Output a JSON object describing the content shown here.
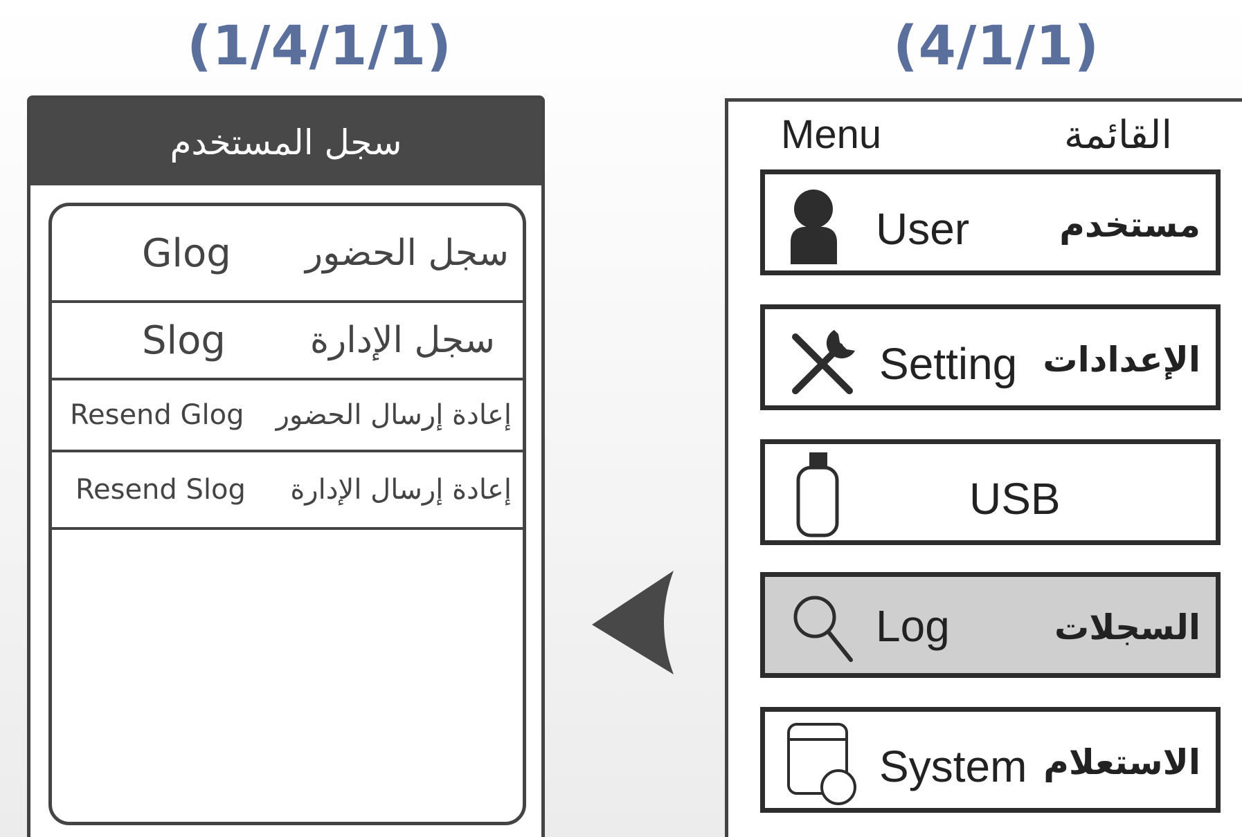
{
  "steps": {
    "left_label": "(1/4/1/1)",
    "right_label": "(4/1/1)"
  },
  "left_screen": {
    "title": "سجل المستخدم",
    "rows": [
      {
        "ar": "سجل الحضور",
        "en": "Glog"
      },
      {
        "ar": "سجل الإدارة",
        "en": "Slog"
      },
      {
        "ar": "إعادة إرسال الحضور",
        "en": "Resend Glog"
      },
      {
        "ar": "إعادة إرسال الإدارة",
        "en": "Resend Slog"
      }
    ]
  },
  "right_screen": {
    "title_en": "Menu",
    "title_ar": "القائمة",
    "items": [
      {
        "en": "User",
        "ar": "مستخدم",
        "icon": "user-icon"
      },
      {
        "en": "Setting",
        "ar": "الإعدادات",
        "icon": "tools-icon"
      },
      {
        "en": "USB",
        "ar": "",
        "icon": "usb-icon"
      },
      {
        "en": "Log",
        "ar": "السجلات",
        "icon": "search-icon",
        "selected": true
      },
      {
        "en": "System",
        "ar": "الاستعلام",
        "icon": "system-icon"
      }
    ]
  },
  "colors": {
    "label_blue": "#5a6f9c",
    "header_dark": "#484848",
    "selected_bg": "#cfcfcf",
    "arrow": "#484848"
  },
  "icons": {
    "back_arrow": "left-pointing-arrow-icon"
  }
}
